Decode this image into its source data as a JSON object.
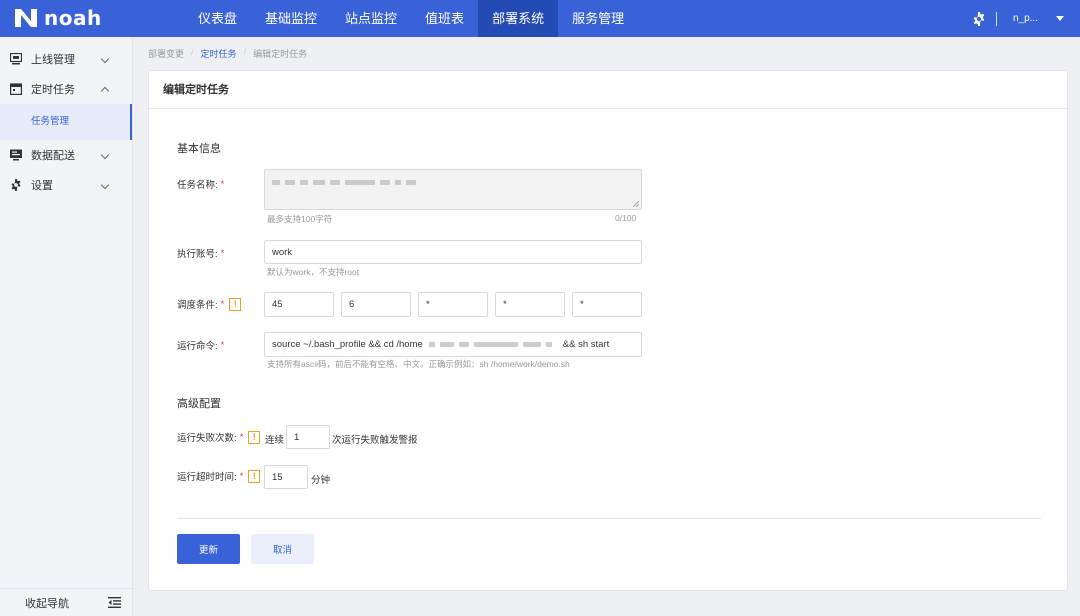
{
  "app": {
    "name": "noah"
  },
  "topnav": {
    "items": [
      "仪表盘",
      "基础监控",
      "站点监控",
      "值班表",
      "部署系统",
      "服务管理"
    ],
    "active_index": 4,
    "user": "n_p..."
  },
  "sidebar": {
    "items": [
      {
        "label": "上线管理",
        "icon": "monitor-icon"
      },
      {
        "label": "定时任务",
        "icon": "calendar-icon"
      },
      {
        "label": "数据配送",
        "icon": "screen-icon"
      },
      {
        "label": "设置",
        "icon": "gear-icon"
      }
    ],
    "sub_item": "任务管理",
    "collapse_label": "收起导航"
  },
  "breadcrumb": [
    "部署变更",
    "定时任务",
    "编辑定时任务"
  ],
  "card": {
    "title": "编辑定时任务"
  },
  "form": {
    "basic_section": "基本信息",
    "task_name": {
      "label": "任务名称:",
      "hint": "最多支持100字符",
      "counter": "0/100"
    },
    "account": {
      "label": "执行账号:",
      "value": "work",
      "hint": "默认为work，不支持root"
    },
    "schedule": {
      "label": "调度条件:",
      "values": [
        "45",
        "6",
        "*",
        "*",
        "*"
      ]
    },
    "command": {
      "label": "运行命令:",
      "value_start": "source ~/.bash_profile && cd /home",
      "value_end": "&& sh start",
      "hint": "支持所有ascii码，前后不能有空格、中文。正确示例如：sh /home/work/demo.sh"
    },
    "advanced_section": "高级配置",
    "fail_count": {
      "label": "运行失败次数:",
      "prefix": "连续",
      "value": "1",
      "suffix": "次运行失败触发警报"
    },
    "timeout": {
      "label": "运行超时时间:",
      "value": "15",
      "suffix": "分钟"
    },
    "submit_label": "更新",
    "cancel_label": "取消"
  },
  "colors": {
    "primary": "#3a62d8",
    "primary_dark": "#234bb3",
    "warning": "#f0a020",
    "required": "#e4393c"
  }
}
